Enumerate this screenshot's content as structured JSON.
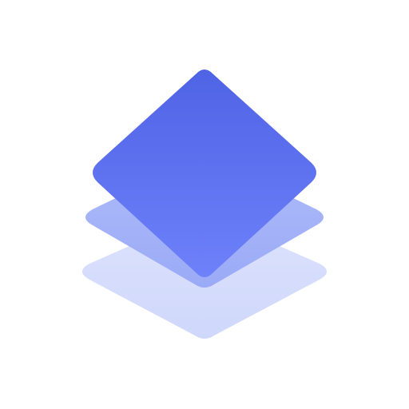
{
  "icon": {
    "name": "stacked-layers-icon",
    "colors": {
      "background": "#FFFFFF",
      "top_layer_start": "#4F63E6",
      "top_layer_end": "#6E81FA",
      "middle_layer": "#A4B3F8",
      "bottom_layer": "#D6DDFC"
    }
  }
}
